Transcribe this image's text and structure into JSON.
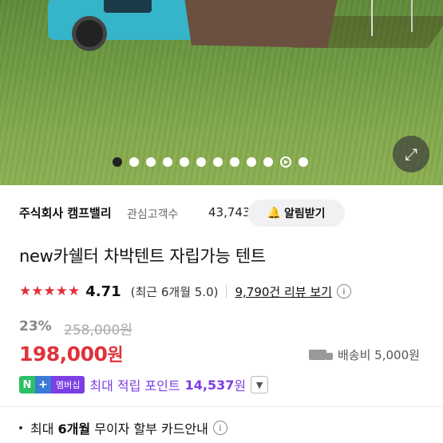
{
  "hero": {
    "slide_count": 12,
    "active_index": 0,
    "video_index": 10
  },
  "seller": {
    "name": "주식회사 캠프밸리",
    "label": "관심고객수",
    "count": "43,743",
    "alarm_label": "알림받기"
  },
  "product": {
    "title": "new카쉘터 차박텐트 자립가능 텐트"
  },
  "rating": {
    "stars": "★★★★★",
    "score": "4.71",
    "recent": "(최근 6개월 5.0)",
    "reviews": "9,790건 리뷰 보기",
    "info": "i"
  },
  "price": {
    "discount": "23%",
    "original": "258,000원",
    "current": "198,000",
    "won": "원",
    "shipping": "배송비 5,000원"
  },
  "points": {
    "n": "N",
    "plus": "+",
    "membership": "멤버십",
    "label": "최대 적립 포인트",
    "value": "14,537",
    "won": "원"
  },
  "card": {
    "prefix": "최대",
    "highlight": "6개월",
    "suffix": "무이자 할부 카드안내"
  },
  "colors": {
    "accent_red": "#e0323b",
    "membership_purple": "#7b3fe4"
  }
}
